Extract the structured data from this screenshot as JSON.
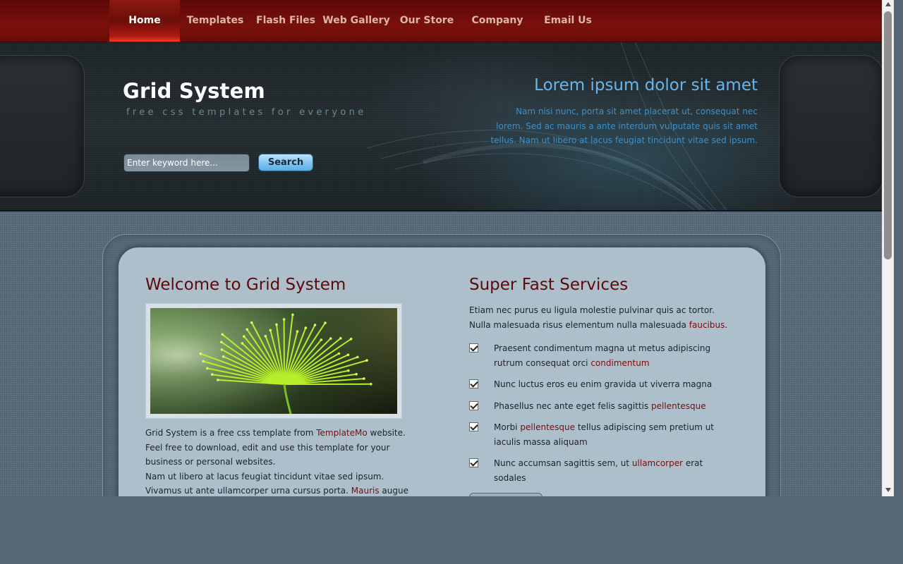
{
  "nav": {
    "items": [
      {
        "label": "Home",
        "active": true
      },
      {
        "label": "Templates"
      },
      {
        "label": "Flash Files"
      },
      {
        "label": "Web Gallery"
      },
      {
        "label": "Our Store"
      },
      {
        "label": "Company"
      },
      {
        "label": "Email Us"
      }
    ]
  },
  "header": {
    "site_title": "Grid System",
    "tagline": "free css templates for everyone",
    "search": {
      "placeholder": "Enter keyword here...",
      "button_label": "Search"
    },
    "heading": "Lorem ipsum dolor sit amet",
    "text": "Nam nisi nunc, porta sit amet placerat ut, consequat nec lorem. Sed ac mauris a ante interdum vulputate quis sit amet tellus. Nam ut libero at lacus feugiat tincidunt vitae sed ipsum."
  },
  "welcome": {
    "heading": "Welcome to Grid System",
    "para1": {
      "before": "Grid System is a free css template from ",
      "link": "TemplateMo",
      "after": " website. Feel free to download, edit and use this template for your business or personal websites."
    },
    "para2": {
      "before": "Nam ut libero at lacus feugiat tincidunt vitae sed ipsum. Vivamus ut ante ullamcorper urna cursus porta. ",
      "link": "Mauris",
      "after": " augue mi, consectetur"
    }
  },
  "services": {
    "heading": "Super Fast Services",
    "intro": {
      "before": "Etiam nec purus eu ligula molestie pulvinar quis ac tortor. Nulla malesuada risus elementum nulla malesuada ",
      "link": "faucibus",
      "after": "."
    },
    "items": [
      {
        "before": "Praesent condimentum magna ut metus adipiscing rutrum consequat orci ",
        "link": "condimentum",
        "after": ""
      },
      {
        "before": "Nunc luctus eros eu enim gravida ut viverra magna",
        "link": "",
        "after": ""
      },
      {
        "before": "Phasellus nec ante eget felis sagittis ",
        "link": "pellentesque",
        "after": ""
      },
      {
        "before": "Morbi ",
        "link": "pellentesque",
        "after": " tellus adipiscing sem pretium ut iaculis massa aliquam"
      },
      {
        "before": "Nunc accumsan sagittis sem, ut ",
        "link": "ullamcorper",
        "after": " erat sodales"
      }
    ]
  },
  "colors": {
    "nav_red": "#7a100a",
    "heading_maroon": "#5a0a0a",
    "link_red": "#7a0c0c",
    "header_blue": "#69b6ea",
    "content_panel": "#aebfcc"
  }
}
